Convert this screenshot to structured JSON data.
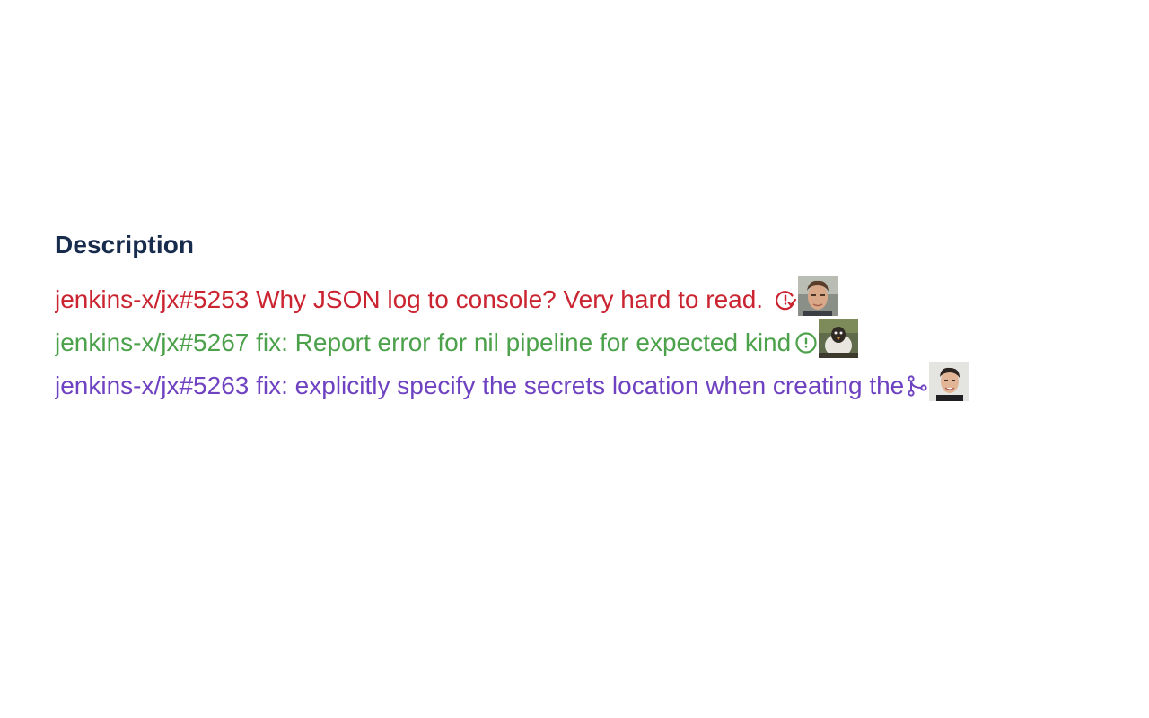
{
  "section": {
    "title": "Description"
  },
  "issues": [
    {
      "text": "jenkins-x/jx#5253 Why JSON log to console? Very hard to read.",
      "state_icon": "issue-closed-icon",
      "color": "#cb2431"
    },
    {
      "text": "jenkins-x/jx#5267 fix: Report error for nil pipeline for expected kind",
      "state_icon": "issue-opened-icon",
      "color": "#4ca14b"
    },
    {
      "text": "jenkins-x/jx#5263 fix: explicitly specify the secrets location when creating the",
      "state_icon": "git-merge-icon",
      "color": "#6f42c1"
    }
  ],
  "colors": {
    "heading": "#172b4d",
    "background": "#ffffff"
  }
}
